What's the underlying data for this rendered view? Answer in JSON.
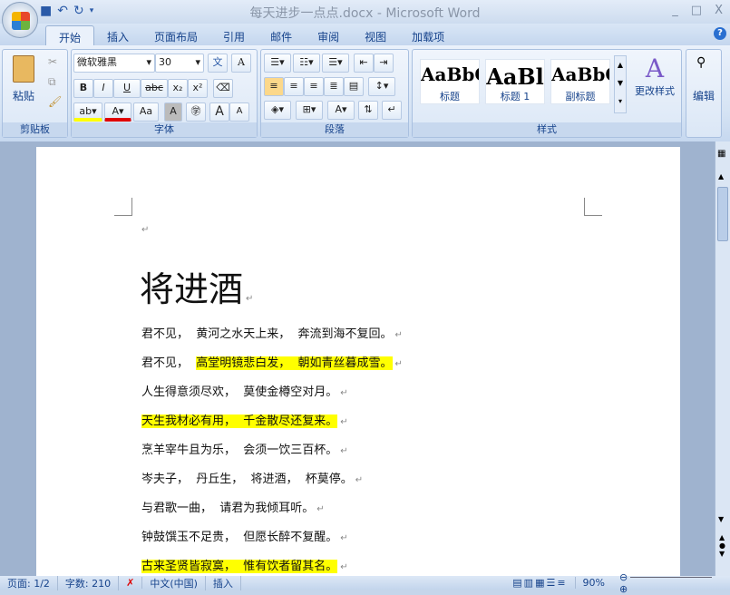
{
  "window": {
    "title": "每天进步一点点.docx - Microsoft Word",
    "controls": [
      "_",
      "□",
      "X"
    ]
  },
  "qat": {
    "save": "save-icon",
    "undo": "↶",
    "redo": "↻"
  },
  "tabs": [
    "开始",
    "插入",
    "页面布局",
    "引用",
    "邮件",
    "审阅",
    "视图",
    "加载项"
  ],
  "ribbon": {
    "clipboard": {
      "paste": "粘贴",
      "label": "剪贴板"
    },
    "font": {
      "name": "微软雅黑",
      "size": "30",
      "label": "字体",
      "bold": "B",
      "italic": "I",
      "underline": "U",
      "strike": "abc",
      "sub": "x₂",
      "sup": "x²",
      "case": "Aa",
      "grow": "A",
      "shrink": "A"
    },
    "paragraph": {
      "label": "段落"
    },
    "styles": {
      "label": "样式",
      "items": [
        {
          "sample": "AaBbC",
          "name": "标题"
        },
        {
          "sample": "AaBl",
          "name": "标题 1"
        },
        {
          "sample": "AaBbC",
          "name": "副标题"
        }
      ],
      "change": "更改样式"
    },
    "editing": {
      "label": "编辑"
    }
  },
  "document": {
    "title": "将进酒",
    "lines": [
      [
        {
          "t": "君不见，  黄河之水天上来，  奔流到海不复回。",
          "hl": false
        }
      ],
      [
        {
          "t": "君不见，  ",
          "hl": false
        },
        {
          "t": "高堂明镜悲白发，  朝如青丝暮成雪。",
          "hl": true
        }
      ],
      [
        {
          "t": "人生得意须尽欢，  莫使金樽空对月。",
          "hl": false
        }
      ],
      [
        {
          "t": "天生我材必有用，  千金散尽还复来。",
          "hl": true
        }
      ],
      [
        {
          "t": "烹羊宰牛且为乐，  会须一饮三百杯。",
          "hl": false
        }
      ],
      [
        {
          "t": "岑夫子，  丹丘生，  将进酒，  杯莫停。",
          "hl": false
        }
      ],
      [
        {
          "t": "与君歌一曲，  请君为我倾耳听。",
          "hl": false
        }
      ],
      [
        {
          "t": "钟鼓馔玉不足贵，  但愿长醉不复醒。",
          "hl": false
        }
      ],
      [
        {
          "t": "古来圣贤皆寂寞，  惟有饮者留其名。",
          "hl": true
        }
      ]
    ],
    "para_mark": "↵",
    "highlight_color": "#ffff00"
  },
  "status": {
    "page": "页面: 1/2",
    "words": "字数: 210",
    "lang": "中文(中国)",
    "mode": "插入",
    "zoom": "90%"
  }
}
